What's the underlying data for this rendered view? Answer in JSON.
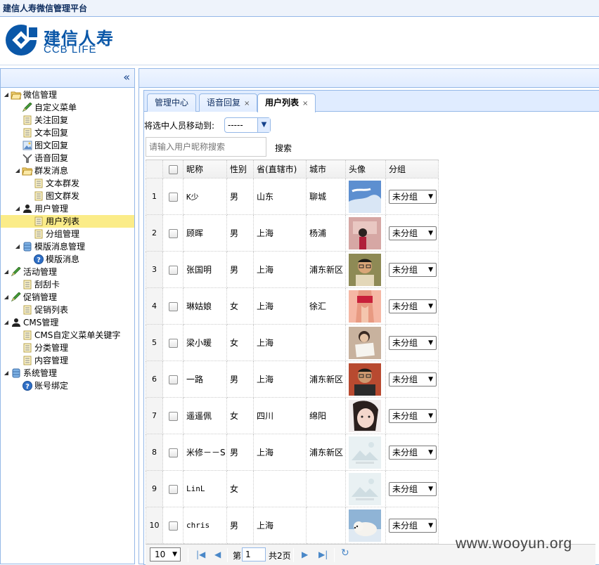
{
  "app": {
    "title": "建信人寿微信管理平台"
  },
  "logo": {
    "cn": "建信人寿",
    "en": "CCB LIFE"
  },
  "tree": [
    {
      "label": "微信管理",
      "icon": "folder-open-icon",
      "depth": 0,
      "expanded": true
    },
    {
      "label": "自定义菜单",
      "icon": "pencil-icon",
      "depth": 1
    },
    {
      "label": "关注回复",
      "icon": "document-icon",
      "depth": 1
    },
    {
      "label": "文本回复",
      "icon": "document-icon",
      "depth": 1
    },
    {
      "label": "图文回复",
      "icon": "image-document-icon",
      "depth": 1
    },
    {
      "label": "语音回复",
      "icon": "filter-icon",
      "depth": 1
    },
    {
      "label": "群发消息",
      "icon": "folder-open-icon",
      "depth": 1,
      "expanded": true
    },
    {
      "label": "文本群发",
      "icon": "document-icon",
      "depth": 2
    },
    {
      "label": "图文群发",
      "icon": "document-icon",
      "depth": 2
    },
    {
      "label": "用户管理",
      "icon": "user-icon",
      "depth": 1,
      "expanded": true
    },
    {
      "label": "用户列表",
      "icon": "document-icon",
      "depth": 2,
      "selected": true
    },
    {
      "label": "分组管理",
      "icon": "document-icon",
      "depth": 2
    },
    {
      "label": "模版消息管理",
      "icon": "database-icon",
      "depth": 1,
      "expanded": true
    },
    {
      "label": "模版消息",
      "icon": "help-icon",
      "depth": 2
    },
    {
      "label": "活动管理",
      "icon": "pencil-icon",
      "depth": 0,
      "expanded": true
    },
    {
      "label": "刮刮卡",
      "icon": "document-icon",
      "depth": 1
    },
    {
      "label": "促销管理",
      "icon": "pencil-icon",
      "depth": 0,
      "expanded": true
    },
    {
      "label": "促销列表",
      "icon": "document-icon",
      "depth": 1
    },
    {
      "label": "CMS管理",
      "icon": "user-icon",
      "depth": 0,
      "expanded": true
    },
    {
      "label": "CMS自定义菜单关键字",
      "icon": "document-icon",
      "depth": 1
    },
    {
      "label": "分类管理",
      "icon": "document-icon",
      "depth": 1
    },
    {
      "label": "内容管理",
      "icon": "document-icon",
      "depth": 1
    },
    {
      "label": "系统管理",
      "icon": "database-icon",
      "depth": 0,
      "expanded": true
    },
    {
      "label": "账号绑定",
      "icon": "help-icon",
      "depth": 1
    }
  ],
  "tabs": [
    {
      "label": "管理中心",
      "closable": false
    },
    {
      "label": "语音回复",
      "closable": true
    },
    {
      "label": "用户列表",
      "closable": true,
      "active": true
    }
  ],
  "tab_close_glyph": "×",
  "move": {
    "label": "将选中人员移动到:",
    "value": "-----"
  },
  "search": {
    "placeholder": "请输入用户昵称搜索",
    "button": "搜索"
  },
  "grid": {
    "columns": [
      "昵称",
      "性别",
      "省(直辖市)",
      "城市",
      "头像",
      "分组"
    ],
    "rows": [
      {
        "n": "1",
        "nickname": "K少",
        "gender": "男",
        "province": "山东",
        "city": "聊城",
        "avatar": "sky-photo",
        "group": "未分组"
      },
      {
        "n": "2",
        "nickname": "顾晖",
        "gender": "男",
        "province": "上海",
        "city": "杨浦",
        "avatar": "child-photo",
        "group": "未分组"
      },
      {
        "n": "3",
        "nickname": "张国明",
        "gender": "男",
        "province": "上海",
        "city": "浦东新区",
        "avatar": "man-glasses-photo",
        "group": "未分组"
      },
      {
        "n": "4",
        "nickname": "琳姑娘",
        "gender": "女",
        "province": "上海",
        "city": "徐汇",
        "avatar": "woman-photo",
        "group": "未分组"
      },
      {
        "n": "5",
        "nickname": "梁小暖",
        "gender": "女",
        "province": "上海",
        "city": "",
        "avatar": "woman-paper-photo",
        "group": "未分组"
      },
      {
        "n": "6",
        "nickname": "一路",
        "gender": "男",
        "province": "上海",
        "city": "浦东新区",
        "avatar": "man-red-photo",
        "group": "未分组"
      },
      {
        "n": "7",
        "nickname": "遥遥佩",
        "gender": "女",
        "province": "四川",
        "city": "绵阳",
        "avatar": "girl-face-photo",
        "group": "未分组"
      },
      {
        "n": "8",
        "nickname": "米修－－S",
        "gender": "男",
        "province": "上海",
        "city": "浦东新区",
        "avatar": "placeholder-image",
        "group": "未分组"
      },
      {
        "n": "9",
        "nickname": "LinL",
        "gender": "女",
        "province": "",
        "city": "",
        "avatar": "placeholder-image",
        "group": "未分组"
      },
      {
        "n": "10",
        "nickname": "chris",
        "gender": "男",
        "province": "上海",
        "city": "",
        "avatar": "polar-bear-photo",
        "group": "未分组"
      }
    ]
  },
  "pager": {
    "page_size": "10",
    "page_prefix": "第",
    "page_value": "1",
    "page_total": "共2页"
  },
  "watermark": "www.wooyun.org"
}
